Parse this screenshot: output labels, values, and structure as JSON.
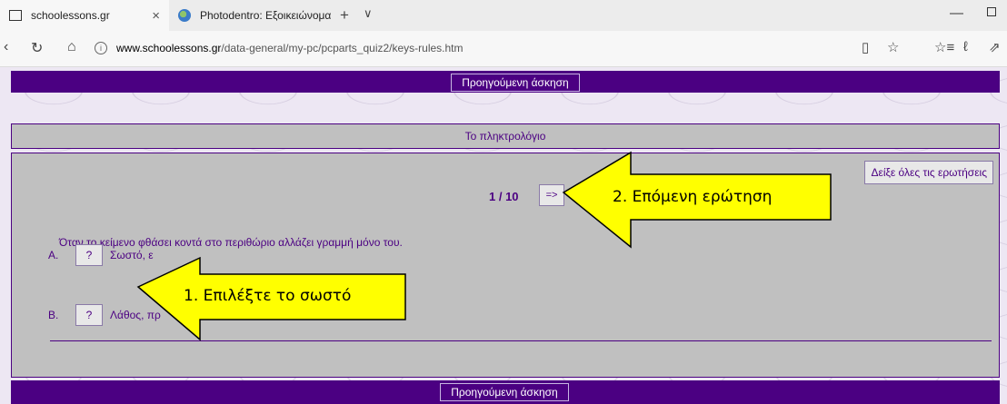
{
  "browser": {
    "tabs": [
      {
        "title": "schoolessons.gr",
        "close": "×"
      },
      {
        "title": "Photodentro: Εξοικειώνομα"
      }
    ],
    "new_tab": "+",
    "tab_menu": "∨",
    "minimize": "—",
    "url_host": "www.schoolessons.gr",
    "url_path": "/data-general/my-pc/pcparts_quiz2/keys-rules.htm",
    "info_glyph": "i"
  },
  "nav": {
    "back": "‹",
    "refresh": "↻",
    "home": "⌂"
  },
  "toolbar": {
    "reading": "▯",
    "favorite": "☆",
    "favorites_list": "☆≡",
    "pen": "ℓ",
    "share": "⇗"
  },
  "page": {
    "prev_exercise_top": "Προηγούμενη άσκηση",
    "prev_exercise_bottom": "Προηγούμενη άσκηση",
    "quiz_title": "Το πληκτρολόγιο",
    "show_all": "Δείξε όλες τις ερωτήσεις",
    "counter": "1 / 10",
    "next_label": "=>",
    "question": "Όταν το κείμενο φθάσει κοντά στο περιθώριο αλλάζει γραμμή μόνο του.",
    "options": [
      {
        "letter": "A.",
        "btn": "?",
        "text": "Σωστό, ε"
      },
      {
        "letter": "B.",
        "btn": "?",
        "text": "Λάθος, πρ"
      }
    ]
  },
  "callouts": {
    "choose_correct": "1. Επιλέξτε το σωστό",
    "next_question": "2. Επόμενη ερώτηση",
    "fill_color": "#ffff00"
  },
  "colors": {
    "accent": "#4b0082",
    "panel": "#c0c0c0"
  }
}
